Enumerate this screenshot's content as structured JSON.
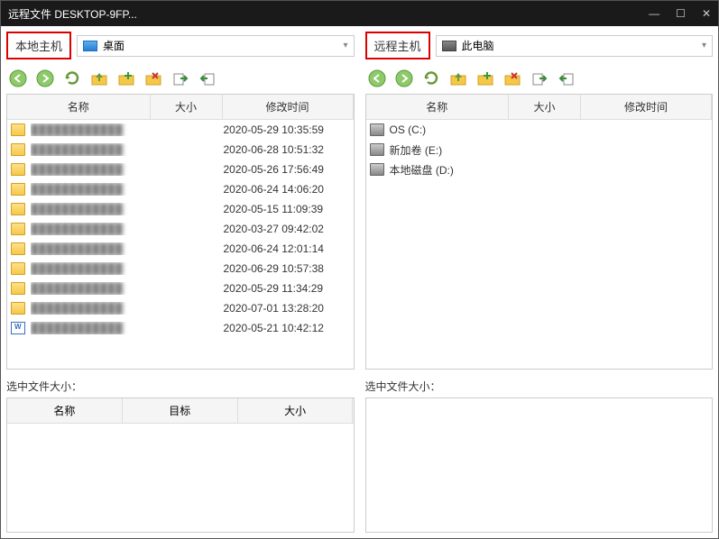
{
  "title": "远程文件 DESKTOP-9FP...",
  "local": {
    "host_label": "本地主机",
    "path": "桌面",
    "columns": {
      "name": "名称",
      "size": "大小",
      "date": "修改时间"
    },
    "files": [
      {
        "name": "████████████",
        "date": "2020-05-29 10:35:59",
        "type": "folder"
      },
      {
        "name": "████████████",
        "date": "2020-06-28 10:51:32",
        "type": "folder"
      },
      {
        "name": "████████████",
        "date": "2020-05-26 17:56:49",
        "type": "folder"
      },
      {
        "name": "████████████",
        "date": "2020-06-24 14:06:20",
        "type": "folder"
      },
      {
        "name": "████████████",
        "date": "2020-05-15 11:09:39",
        "type": "folder"
      },
      {
        "name": "████████████",
        "date": "2020-03-27 09:42:02",
        "type": "folder"
      },
      {
        "name": "████████████",
        "date": "2020-06-24 12:01:14",
        "type": "folder"
      },
      {
        "name": "████████████",
        "date": "2020-06-29 10:57:38",
        "type": "folder"
      },
      {
        "name": "████████████",
        "date": "2020-05-29 11:34:29",
        "type": "folder"
      },
      {
        "name": "████████████",
        "date": "2020-07-01 13:28:20",
        "type": "folder"
      },
      {
        "name": "████████████",
        "date": "2020-05-21 10:42:12",
        "type": "doc"
      }
    ],
    "selected_label": "选中文件大小：",
    "queue_columns": {
      "name": "名称",
      "target": "目标",
      "size": "大小"
    }
  },
  "remote": {
    "host_label": "远程主机",
    "path": "此电脑",
    "columns": {
      "name": "名称",
      "size": "大小",
      "date": "修改时间"
    },
    "drives": [
      {
        "name": "OS (C:)"
      },
      {
        "name": "新加卷 (E:)"
      },
      {
        "name": "本地磁盘 (D:)"
      }
    ],
    "selected_label": "选中文件大小："
  }
}
